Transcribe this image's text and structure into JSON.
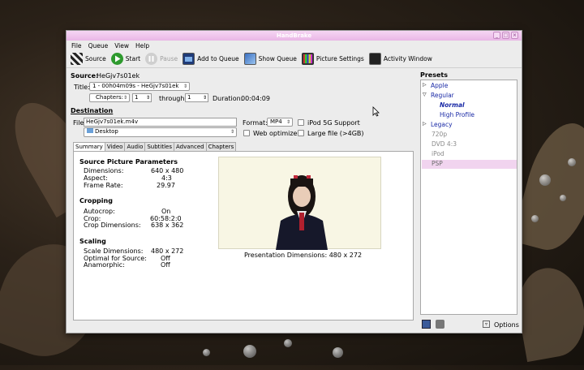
{
  "window": {
    "title": "HandBrake",
    "controls": [
      "_",
      "□",
      "×"
    ]
  },
  "menu": [
    "File",
    "Queue",
    "View",
    "Help"
  ],
  "toolbar": {
    "source": "Source",
    "start": "Start",
    "pause": "Pause",
    "add_queue": "Add to Queue",
    "show_queue": "Show Queue",
    "picture_settings": "Picture Settings",
    "activity_window": "Activity Window"
  },
  "source": {
    "label": "Source:",
    "value": "HeGjv7s01ek",
    "title_label": "Title:",
    "title_value": "1 - 00h04m09s - HeGjv7s01ek",
    "range_type": "Chapters:",
    "start": "1",
    "through_label": "through",
    "end": "1",
    "duration_label": "Duration:",
    "duration": "00:04:09"
  },
  "destination": {
    "label": "Destination",
    "file_label": "File:",
    "file_value": "HeGjv7s01ek.m4v",
    "folder": "Desktop",
    "format_label": "Format:",
    "format_value": "MP4",
    "ipod": "iPod 5G Support",
    "web": "Web optimized",
    "large": "Large file (>4GB)"
  },
  "tabs": [
    "Summary",
    "Video",
    "Audio",
    "Subtitles",
    "Advanced",
    "Chapters"
  ],
  "summary": {
    "source_params_title": "Source Picture Parameters",
    "dimensions_label": "Dimensions:",
    "dimensions": "640 x 480",
    "aspect_label": "Aspect:",
    "aspect": "4:3",
    "framerate_label": "Frame Rate:",
    "framerate": "29.97",
    "cropping_title": "Cropping",
    "autocrop_label": "Autocrop:",
    "autocrop": "On",
    "crop_label": "Crop:",
    "crop": "60:58:2:0",
    "crop_dim_label": "Crop Dimensions:",
    "crop_dim": "638 x 362",
    "scaling_title": "Scaling",
    "scale_dim_label": "Scale Dimensions:",
    "scale_dim": "480 x 272",
    "optimal_label": "Optimal for Source:",
    "optimal": "Off",
    "anamorphic_label": "Anamorphic:",
    "anamorphic": "Off",
    "presentation": "Presentation Dimensions:  480 x 272"
  },
  "presets": {
    "title": "Presets",
    "items": [
      "Apple",
      "Regular",
      "Normal",
      "High Profile",
      "Legacy",
      "720p",
      "DVD 4:3",
      "iPod",
      "PSP"
    ],
    "options": "Options"
  },
  "colors": {
    "title_pink": "#e9b6e6",
    "selected": "#f1d4ef",
    "link_blue": "#1a2aa6"
  }
}
